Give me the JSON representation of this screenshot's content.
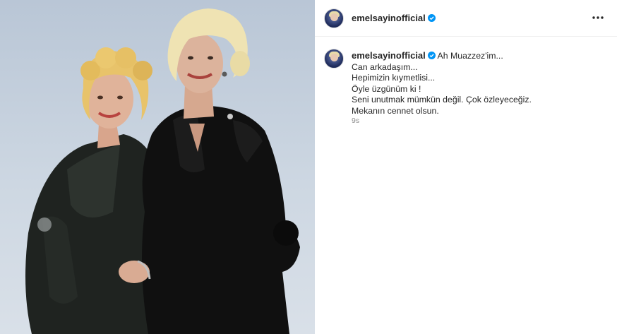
{
  "post": {
    "author": {
      "username": "emelsayinofficial",
      "verified": true,
      "avatar_icon": "profile-avatar-icon"
    },
    "more_icon": "more-options-icon",
    "caption": {
      "username": "emelsayinofficial",
      "first_line": "Ah Muazzez'im...",
      "lines": [
        "Can arkadaşım...",
        "Hepimizin kıymetlisi...",
        "Öyle üzgünüm ki !",
        "Seni unutmak mümkün değil. Çok özleyeceğiz.",
        "Mekanın cennet olsun."
      ],
      "time": "9s"
    },
    "colors": {
      "verified_badge": "#0095f6",
      "secondary_text": "#8e8e8e",
      "primary_text": "#262626"
    }
  }
}
